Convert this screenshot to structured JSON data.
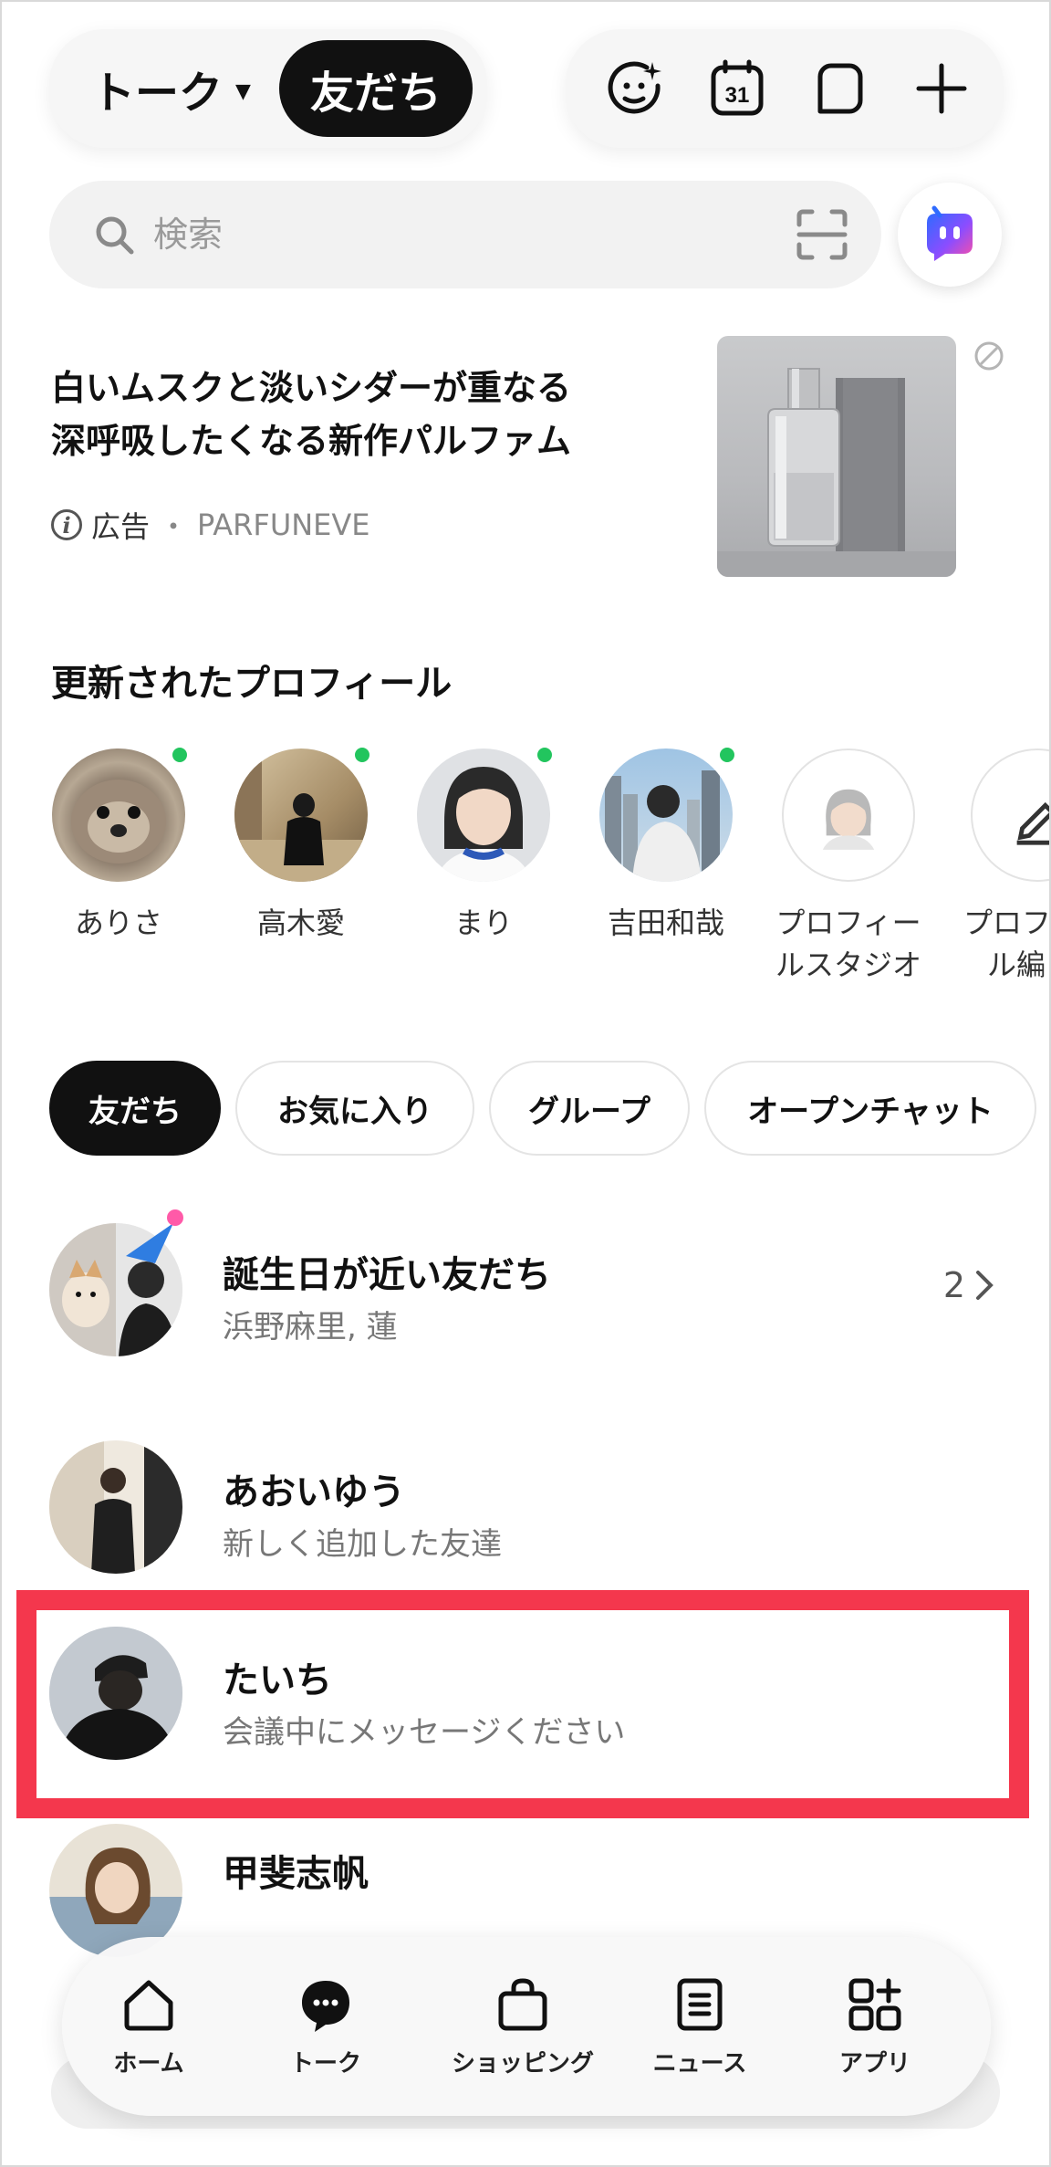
{
  "header": {
    "talk_tab": "トーク",
    "friends_tab": "友だち",
    "tools": [
      {
        "name": "sticker-face-icon"
      },
      {
        "name": "calendar-icon",
        "label": "31"
      },
      {
        "name": "chat-bubble-icon"
      },
      {
        "name": "plus-icon"
      }
    ]
  },
  "search": {
    "placeholder": "検索"
  },
  "ad": {
    "title_line1": "白いムスクと淡いシダーが重なる",
    "title_line2": "深呼吸したくなる新作パルファム",
    "label": "広告",
    "separator": "・",
    "sponsor": "PARFUNEVE"
  },
  "profiles": {
    "title": "更新されたプロフィール",
    "items": [
      {
        "name": "ありさ",
        "online": true
      },
      {
        "name": "高木愛",
        "online": true
      },
      {
        "name": "まり",
        "online": true
      },
      {
        "name": "吉田和哉",
        "online": true
      },
      {
        "name_line1": "プロフィー",
        "name_line2": "ルスタジオ"
      },
      {
        "name_line1": "プロフ",
        "name_line2": "ル編"
      }
    ]
  },
  "filters": [
    {
      "label": "友だち",
      "active": true
    },
    {
      "label": "お気に入り"
    },
    {
      "label": "グループ"
    },
    {
      "label": "オープンチャット"
    }
  ],
  "friends": {
    "birthday": {
      "title": "誕生日が近い友だち",
      "names": "浜野麻里, 蓮",
      "count": "2"
    },
    "rows": [
      {
        "name": "あおいゆう",
        "status": "新しく追加した友達"
      },
      {
        "name": "たいち",
        "status": "会議中にメッセージください"
      },
      {
        "name": "甲斐志帆"
      }
    ]
  },
  "bottom_nav": [
    {
      "label": "ホーム",
      "icon": "home-icon"
    },
    {
      "label": "トーク",
      "icon": "talk-icon",
      "active": true
    },
    {
      "label": "ショッピング",
      "icon": "shopping-bag-icon"
    },
    {
      "label": "ニュース",
      "icon": "news-icon"
    },
    {
      "label": "アプリ",
      "icon": "apps-icon"
    }
  ],
  "colors": {
    "accent_dark": "#111111",
    "online_dot": "#22c55e",
    "highlight_border": "#f4374d"
  }
}
